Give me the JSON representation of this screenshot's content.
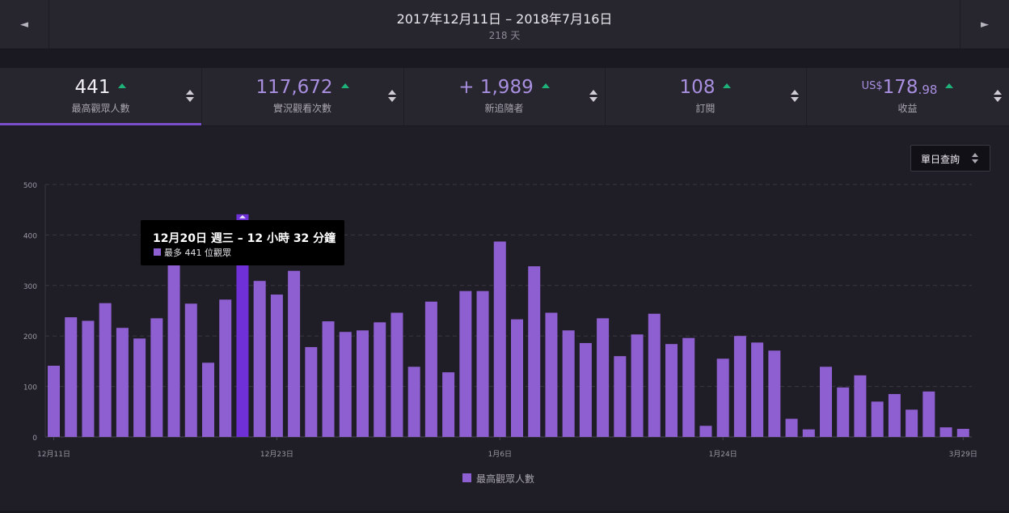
{
  "header": {
    "prev_icon": "◄",
    "next_icon": "►",
    "date_range": "2017年12月11日 – 2018年7月16日",
    "days": "218 天"
  },
  "stats": [
    {
      "value": "441",
      "label": "最高觀眾人數",
      "trend": "up",
      "active": true
    },
    {
      "value": "117,672",
      "label": "實況觀看次數",
      "trend": "up",
      "active": false
    },
    {
      "value": "+ 1,989",
      "label": "新追隨者",
      "trend": "up",
      "active": false
    },
    {
      "value": "108",
      "label": "訂閱",
      "trend": "up",
      "active": false
    },
    {
      "value_prefix": "US$",
      "value": "178",
      "value_suffix": ".98",
      "label": "收益",
      "trend": "up",
      "active": false
    }
  ],
  "dropdown": {
    "label": "單日查詢"
  },
  "tooltip": {
    "title": "12月20日 週三 – 12 小時 32 分鐘",
    "text": "最多 441 位觀眾"
  },
  "legend": {
    "label": "最高觀眾人數"
  },
  "colors": {
    "bar": "#8e5fd0",
    "bar_highlight": "#6f30d8",
    "trend_up": "#1fb37a",
    "accent": "#7b4fc9"
  },
  "chart_data": {
    "type": "bar",
    "series": [
      {
        "name": "最高觀眾人數",
        "values": [
          141,
          237,
          230,
          265,
          216,
          195,
          235,
          357,
          264,
          147,
          272,
          441,
          309,
          282,
          329,
          178,
          229,
          208,
          211,
          227,
          246,
          139,
          268,
          128,
          289,
          289,
          387,
          233,
          338,
          246,
          211,
          186,
          235,
          160,
          203,
          244,
          184,
          196,
          22,
          155,
          200,
          187,
          171,
          36,
          15,
          139,
          98,
          122,
          70,
          85,
          54,
          90,
          19,
          16
        ]
      }
    ],
    "highlight_index": 11,
    "x_tick_labels": [
      "12月11日",
      "12月23日",
      "1月6日",
      "1月24日",
      "3月29日"
    ],
    "x_tick_indices": [
      0,
      13,
      26,
      39,
      53
    ],
    "y_ticks": [
      0,
      100,
      200,
      300,
      400,
      500
    ],
    "ylim": [
      0,
      500
    ],
    "grid": true,
    "legend_position": "bottom-center"
  }
}
